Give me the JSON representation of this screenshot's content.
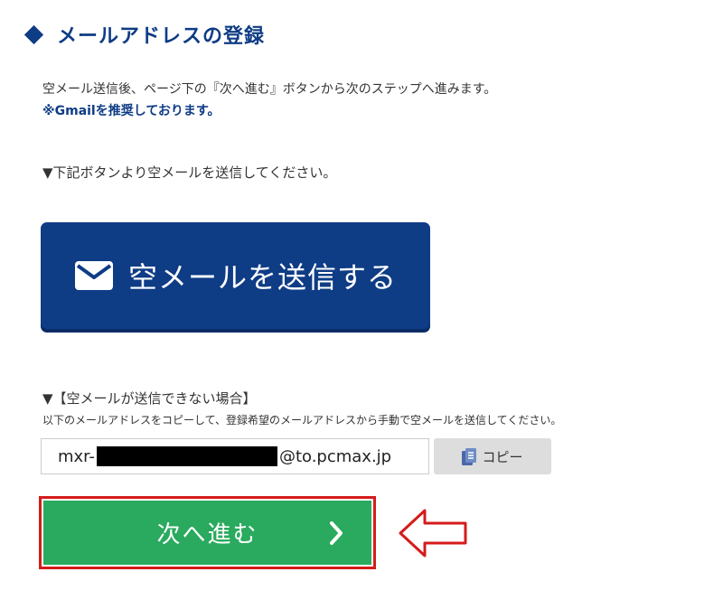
{
  "section": {
    "title": "メールアドレスの登録",
    "intro": "空メール送信後、ページ下の『次へ進む』ボタンから次のステップへ進みます。",
    "note": "※Gmailを推奨しております。"
  },
  "send": {
    "instruction": "▼下記ボタンより空メールを送信してください。",
    "button_label": "空メールを送信する",
    "icon": "envelope-icon"
  },
  "fallback": {
    "title": "▼【空メールが送信できない場合】",
    "description": "以下のメールアドレスをコピーして、登録希望のメールアドレスから手動で空メールを送信してください。",
    "email_prefix": "mxr-",
    "email_suffix": "@to.pcmax.jp",
    "copy_label": "コピー",
    "copy_icon": "copy-icon"
  },
  "next": {
    "label": "次へ進む",
    "icon": "chevron-right-icon"
  },
  "colors": {
    "navy": "#0e3c85",
    "green": "#2aaa5e",
    "red": "#d51b1b",
    "gray_button": "#dddddd"
  }
}
